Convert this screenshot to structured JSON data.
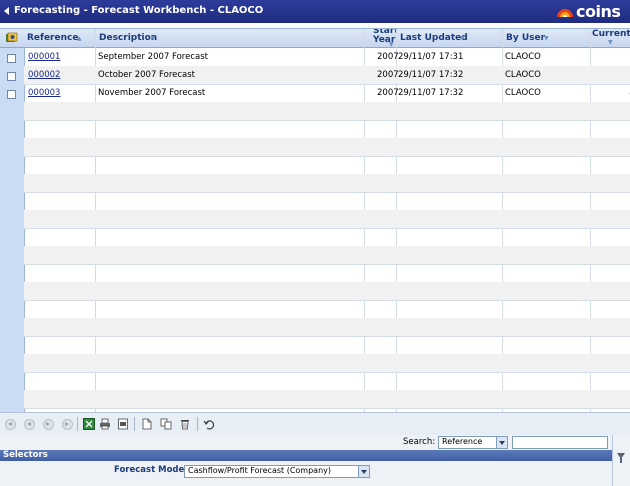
{
  "window": {
    "title": "Forecasting - Forecast Workbench - CLAOCO",
    "logo_text": "coins"
  },
  "grid": {
    "columns": [
      {
        "key": "reference",
        "label": "Reference"
      },
      {
        "key": "description",
        "label": "Description"
      },
      {
        "key": "start_year",
        "label": "Start Year"
      },
      {
        "key": "last_updated",
        "label": "Last Updated"
      },
      {
        "key": "by_user",
        "label": "By User"
      },
      {
        "key": "current",
        "label": "Current"
      }
    ],
    "rows": [
      {
        "reference": "000001",
        "description": "September 2007 Forecast",
        "start_year": "2007",
        "last_updated": "29/11/07 17:31",
        "by_user": "CLAOCO",
        "current": false
      },
      {
        "reference": "000002",
        "description": "October 2007 Forecast",
        "start_year": "2007",
        "last_updated": "29/11/07 17:32",
        "by_user": "CLAOCO",
        "current": false
      },
      {
        "reference": "000003",
        "description": "November 2007 Forecast",
        "start_year": "2007",
        "last_updated": "29/11/07 17:32",
        "by_user": "CLAOCO",
        "current": true
      }
    ]
  },
  "toolbar": {
    "icons": [
      "first-page-icon",
      "previous-page-icon",
      "next-page-icon",
      "last-page-icon",
      "excel-export-icon",
      "print-icon",
      "pdf-export-icon",
      "new-document-icon",
      "copy-icon",
      "delete-icon",
      "undo-icon"
    ]
  },
  "search": {
    "label": "Search:",
    "field_value": "Reference",
    "input_value": ""
  },
  "selectors": {
    "header": "Selectors",
    "forecast_model_label": "Forecast Model:",
    "forecast_model_value": "Cashflow/Profit Forecast (Company)"
  },
  "colors": {
    "title_bar": "#1f2c80",
    "selectors_header": "#3f5ea3",
    "link": "#1b2a8f",
    "current_tick": "#2b8a2b"
  }
}
